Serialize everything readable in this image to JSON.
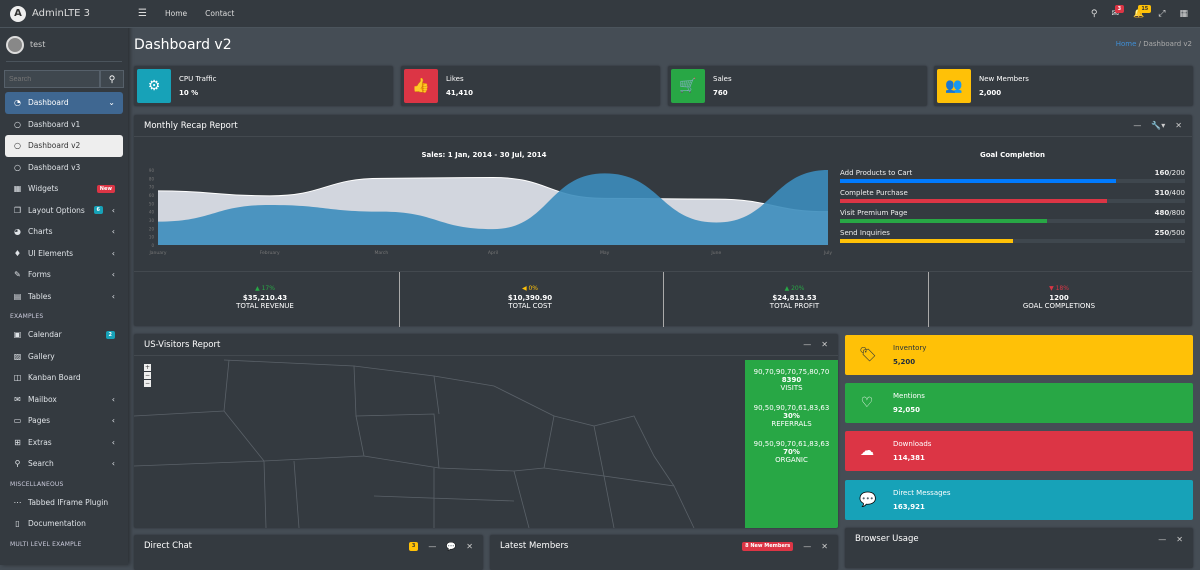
{
  "brand": "AdminLTE 3",
  "user": "test",
  "search_placeholder": "Search",
  "sidebar": {
    "items": [
      {
        "label": "Dashboard",
        "icon": "tachometer-icon",
        "state": "active",
        "arrow": true
      },
      {
        "label": "Dashboard v1",
        "icon": "circle-icon"
      },
      {
        "label": "Dashboard v2",
        "icon": "circle-icon",
        "state": "selected"
      },
      {
        "label": "Dashboard v3",
        "icon": "circle-icon"
      },
      {
        "label": "Widgets",
        "icon": "th-icon",
        "badge": "New",
        "badge_color": "#dc3545"
      },
      {
        "label": "Layout Options",
        "icon": "copy-icon",
        "badge": "6",
        "badge_color": "#17a2b8",
        "arrow": true
      },
      {
        "label": "Charts",
        "icon": "pie-chart-icon",
        "arrow": true
      },
      {
        "label": "UI Elements",
        "icon": "tree-icon",
        "arrow": true
      },
      {
        "label": "Forms",
        "icon": "edit-icon",
        "arrow": true
      },
      {
        "label": "Tables",
        "icon": "table-icon",
        "arrow": true
      }
    ],
    "examples_header": "EXAMPLES",
    "examples": [
      {
        "label": "Calendar",
        "icon": "calendar-icon",
        "badge": "2",
        "badge_color": "#17a2b8"
      },
      {
        "label": "Gallery",
        "icon": "image-icon"
      },
      {
        "label": "Kanban Board",
        "icon": "columns-icon"
      },
      {
        "label": "Mailbox",
        "icon": "envelope-icon",
        "arrow": true
      },
      {
        "label": "Pages",
        "icon": "book-icon",
        "arrow": true
      },
      {
        "label": "Extras",
        "icon": "plus-square-icon",
        "arrow": true
      },
      {
        "label": "Search",
        "icon": "search-icon",
        "arrow": true
      }
    ],
    "misc_header": "MISCELLANEOUS",
    "misc": [
      {
        "label": "Tabbed IFrame Plugin",
        "icon": "ellipsis-icon"
      },
      {
        "label": "Documentation",
        "icon": "file-icon"
      }
    ],
    "multi_header": "MULTI LEVEL EXAMPLE"
  },
  "topnav": {
    "home": "Home",
    "contact": "Contact",
    "messages_badge": "3",
    "notifications_badge": "15"
  },
  "page": {
    "title": "Dashboard v2",
    "breadcrumb_home": "Home",
    "breadcrumb_current": "Dashboard v2"
  },
  "info_boxes": [
    {
      "label": "CPU Traffic",
      "value": "10 %",
      "icon": "cog-icon",
      "color": "#17a2b8"
    },
    {
      "label": "Likes",
      "value": "41,410",
      "icon": "thumbs-up-icon",
      "color": "#dc3545"
    },
    {
      "label": "Sales",
      "value": "760",
      "icon": "shopping-cart-icon",
      "color": "#28a745"
    },
    {
      "label": "New Members",
      "value": "2,000",
      "icon": "users-icon",
      "color": "#ffc107"
    }
  ],
  "recap": {
    "title": "Monthly Recap Report",
    "goal_title": "Goal Completion",
    "goals": [
      {
        "label": "Add Products to Cart",
        "done": "160",
        "total": "/200",
        "pct": 80,
        "color": "#007bff"
      },
      {
        "label": "Complete Purchase",
        "done": "310",
        "total": "/400",
        "pct": 77.5,
        "color": "#dc3545"
      },
      {
        "label": "Visit Premium Page",
        "done": "480",
        "total": "/800",
        "pct": 60,
        "color": "#28a745"
      },
      {
        "label": "Send Inquiries",
        "done": "250",
        "total": "/500",
        "pct": 50,
        "color": "#ffc107"
      }
    ],
    "stats": [
      {
        "pct": "▲ 17%",
        "value": "$35,210.43",
        "label": "TOTAL REVENUE",
        "color": "#28a745"
      },
      {
        "pct": "◀ 0%",
        "value": "$10,390.90",
        "label": "TOTAL COST",
        "color": "#ffc107"
      },
      {
        "pct": "▲ 20%",
        "value": "$24,813.53",
        "label": "TOTAL PROFIT",
        "color": "#28a745"
      },
      {
        "pct": "▼ 18%",
        "value": "1200",
        "label": "GOAL COMPLETIONS",
        "color": "#dc3545"
      }
    ]
  },
  "chart_data": {
    "type": "area",
    "title": "Sales: 1 Jan, 2014 - 30 Jul, 2014",
    "categories": [
      "January",
      "February",
      "March",
      "April",
      "May",
      "June",
      "July"
    ],
    "series": [
      {
        "values": [
          65,
          59,
          80,
          81,
          56,
          55,
          40
        ],
        "color": "#d2d6de"
      },
      {
        "values": [
          28,
          48,
          40,
          19,
          86,
          27,
          90
        ],
        "color": "#3c8dbc"
      }
    ],
    "ylim": [
      0,
      90
    ],
    "yticks": [
      0,
      10,
      20,
      30,
      40,
      50,
      60,
      70,
      80,
      90
    ],
    "grid": false
  },
  "visitors": {
    "title": "US-Visitors Report",
    "stats": [
      {
        "spark": "90,70,90,70,75,80,70",
        "value": "8390",
        "label": "VISITS"
      },
      {
        "spark": "90,50,90,70,61,83,63",
        "value": "30%",
        "label": "REFERRALS"
      },
      {
        "spark": "90,50,90,70,61,83,63",
        "value": "70%",
        "label": "ORGANIC"
      }
    ]
  },
  "side_boxes": [
    {
      "label": "Inventory",
      "value": "5,200",
      "icon": "tag-icon",
      "color": "#ffc107",
      "text": "#1f2d3d"
    },
    {
      "label": "Mentions",
      "value": "92,050",
      "icon": "heart-icon",
      "color": "#28a745",
      "text": "#fff"
    },
    {
      "label": "Downloads",
      "value": "114,381",
      "icon": "cloud-download-icon",
      "color": "#dc3545",
      "text": "#fff"
    },
    {
      "label": "Direct Messages",
      "value": "163,921",
      "icon": "comment-icon",
      "color": "#17a2b8",
      "text": "#fff"
    }
  ],
  "browser_usage": {
    "title": "Browser Usage"
  },
  "direct_chat": {
    "title": "Direct Chat",
    "badge": "3"
  },
  "latest_members": {
    "title": "Latest Members",
    "badge": "8 New Members"
  }
}
